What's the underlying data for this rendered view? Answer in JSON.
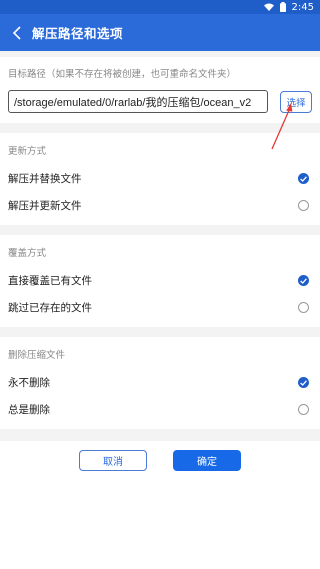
{
  "status_bar": {
    "time": "2:45",
    "icons": [
      "wifi-icon",
      "battery-icon"
    ]
  },
  "app_bar": {
    "title": "解压路径和选项",
    "back_icon": "chevron-left-icon"
  },
  "target": {
    "label": "目标路径（如果不存在将被创建，也可重命名文件夹）",
    "path": "/storage/emulated/0/rarlab/我的压缩包/ocean_v2",
    "choose_label": "选择"
  },
  "update_mode": {
    "label": "更新方式",
    "options": [
      {
        "label": "解压并替换文件",
        "selected": true
      },
      {
        "label": "解压并更新文件",
        "selected": false
      }
    ]
  },
  "overwrite_mode": {
    "label": "覆盖方式",
    "options": [
      {
        "label": "直接覆盖已有文件",
        "selected": true
      },
      {
        "label": "跳过已存在的文件",
        "selected": false
      }
    ]
  },
  "delete_archive": {
    "label": "删除压缩文件",
    "options": [
      {
        "label": "永不删除",
        "selected": true
      },
      {
        "label": "总是删除",
        "selected": false
      }
    ]
  },
  "buttons": {
    "cancel_label": "取消",
    "ok_label": "确定"
  },
  "colors": {
    "primary": "#2a6ad9",
    "status_bar": "#1f5ec9",
    "annotation": "#e53935"
  }
}
